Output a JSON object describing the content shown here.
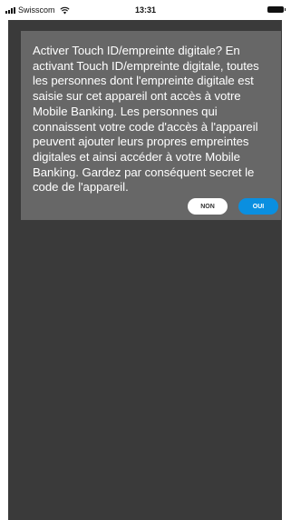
{
  "status_bar": {
    "carrier": "Swisscom",
    "time": "13:31",
    "signal_icon": "signal-bars-icon",
    "wifi_icon": "wifi-icon",
    "battery_icon": "battery-icon"
  },
  "dialog": {
    "message": "Activer Touch ID/empreinte digitale? En activant Touch ID/empreinte digitale, toutes les personnes dont l'empreinte digitale est saisie sur cet appareil ont accès à votre Mobile Banking. Les personnes qui connaissent votre code d'accès à l'appareil peuvent ajouter leurs propres empreintes digitales et ainsi accéder à votre Mobile Banking. Gardez par conséquent secret le code de l'appareil.",
    "decline_label": "NON",
    "accept_label": "OUI"
  },
  "colors": {
    "overlay_background": "#3a3a3a",
    "dialog_background": "#676767",
    "accept_button": "#0a8fe0",
    "decline_button": "#ffffff"
  }
}
